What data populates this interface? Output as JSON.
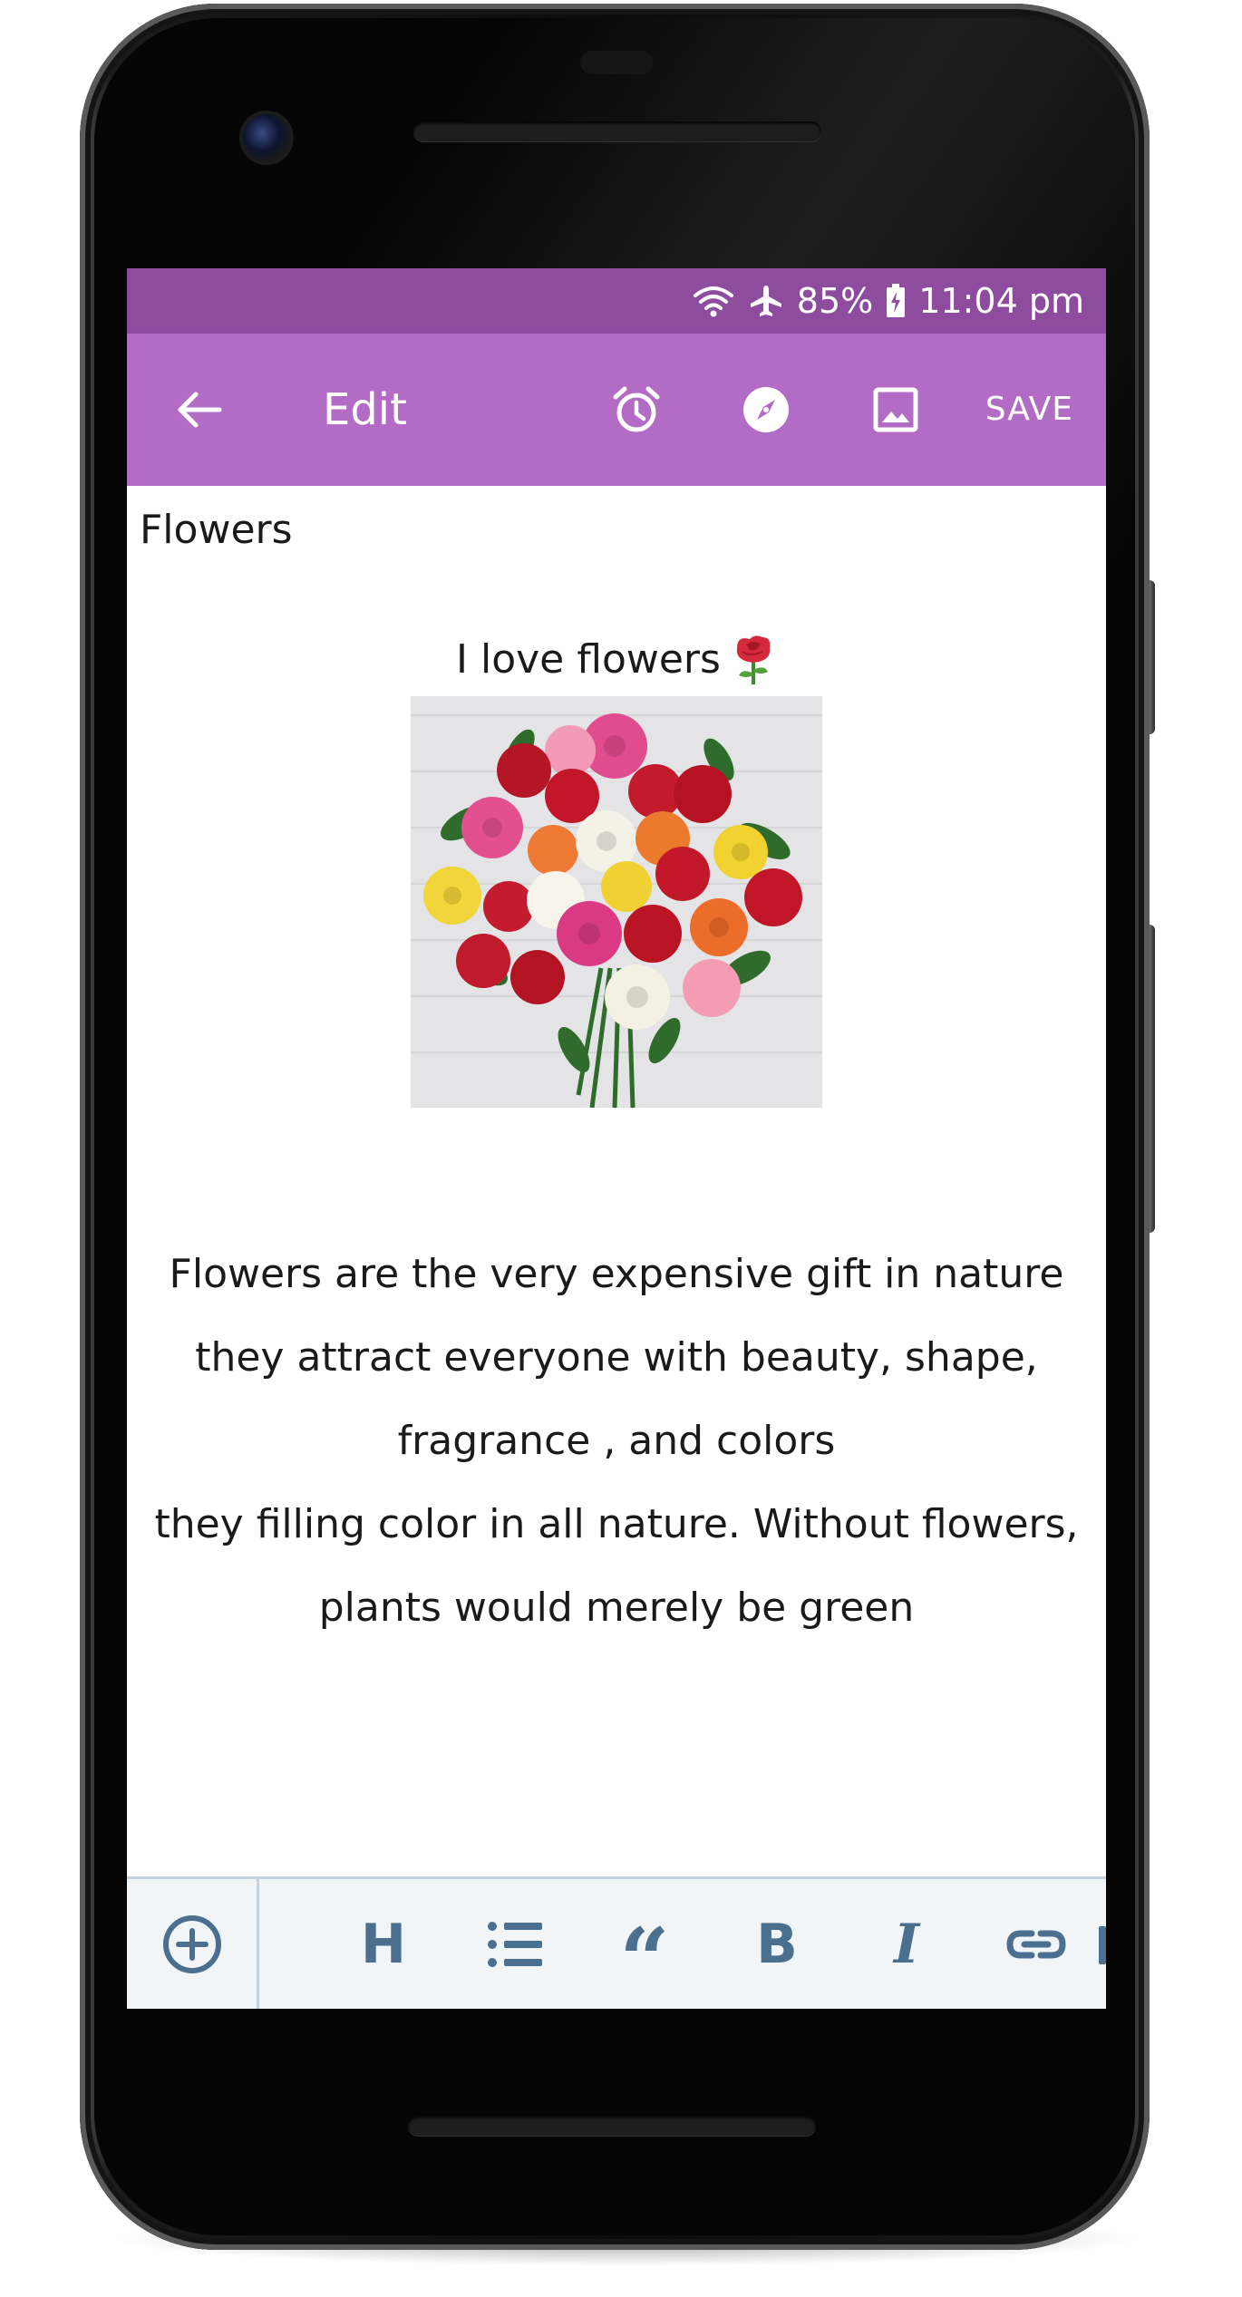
{
  "status_bar": {
    "battery": "85%",
    "time": "11:04 pm",
    "icons": [
      "wifi-icon",
      "airplane-icon",
      "battery-icon"
    ]
  },
  "toolbar": {
    "title": "Edit",
    "save_label": "SAVE",
    "icons": [
      "back-arrow-icon",
      "alarm-icon",
      "compass-icon",
      "image-icon"
    ]
  },
  "note": {
    "title": "Flowers",
    "heading": "I love flowers",
    "heading_emoji": "rose-icon",
    "image": "bouquet-image",
    "paragraph_lines": [
      "Flowers are the very expensive gift in nature",
      "they attract everyone with beauty, shape,",
      "fragrance , and colors",
      "they filling color in all nature. Without flowers,",
      "plants would merely be green"
    ]
  },
  "format_bar": {
    "buttons": [
      "add-icon",
      "heading-icon",
      "bullet-list-icon",
      "quote-icon",
      "bold-icon",
      "italic-icon",
      "link-icon"
    ],
    "heading_label": "H",
    "bold_label": "B",
    "italic_label": "I",
    "quote_label": "“"
  },
  "colors": {
    "status_bar": "#8e4c9f",
    "toolbar": "#b36cc6",
    "format_bar": "#f1f5f8",
    "format_icon": "#4b6f8e"
  }
}
